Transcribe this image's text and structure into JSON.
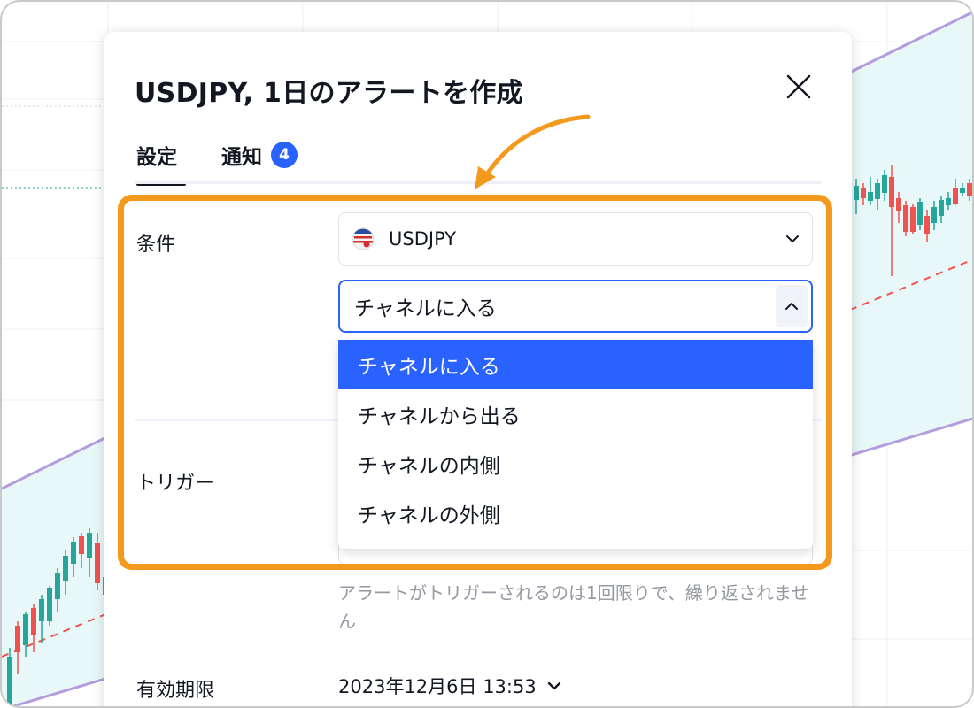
{
  "dialog": {
    "title": "USDJPY, 1日のアラートを作成"
  },
  "tabs": [
    {
      "label": "設定",
      "active": true
    },
    {
      "label": "通知",
      "badge": "4"
    }
  ],
  "condition": {
    "label": "条件",
    "symbol": "USDJPY",
    "symbol_icon": "us-japan-flag-icon",
    "selected": "チャネルに入る",
    "options": [
      "チャネルに入る",
      "チャネルから出る",
      "チャネルの内側",
      "チャネルの外側"
    ]
  },
  "trigger": {
    "label": "トリガー",
    "helper": "アラートがトリガーされるのは1回限りで、繰り返されません"
  },
  "expiry": {
    "label": "有効期限",
    "value": "2023年12月6日 13:53"
  },
  "colors": {
    "accent": "#2962ff",
    "highlight": "#f39a1e",
    "candle_up": "#26a69a",
    "candle_down": "#ef5350",
    "channel": "#b39ddb"
  }
}
